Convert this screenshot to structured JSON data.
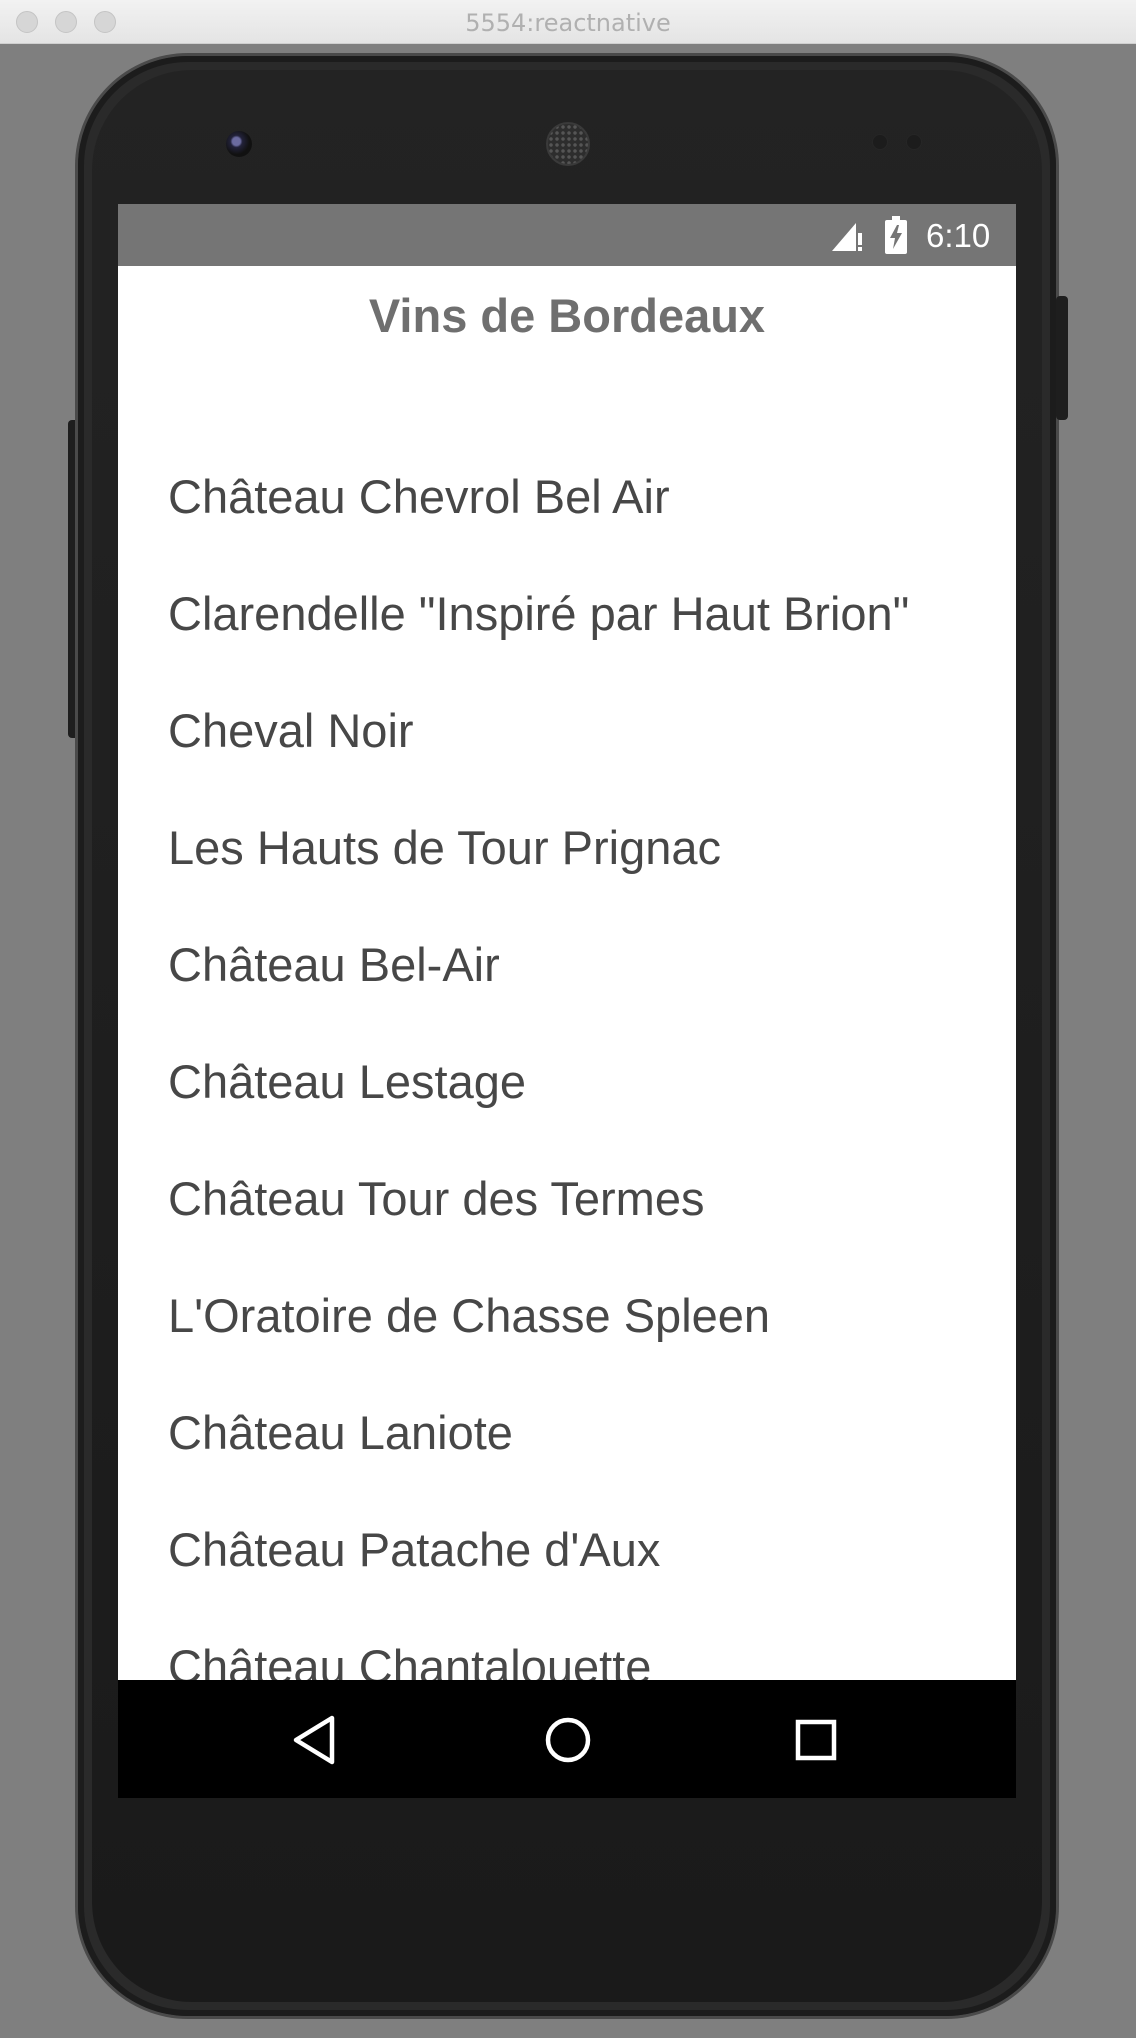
{
  "window": {
    "title": "5554:reactnative"
  },
  "status_bar": {
    "time": "6:10",
    "signal_icon": "signal-no-data-icon",
    "battery_icon": "battery-charging-icon"
  },
  "app": {
    "title": "Vins de Bordeaux",
    "wines": [
      "Château Chevrol Bel Air",
      "Clarendelle \"Inspiré par Haut Brion\"",
      "Cheval Noir",
      "Les Hauts de Tour Prignac",
      "Château Bel-Air",
      "Château Lestage",
      "Château Tour des Termes",
      "L'Oratoire de Chasse Spleen",
      "Château Laniote",
      "Château Patache d'Aux",
      "Château Chantalouette"
    ]
  },
  "nav_bar": {
    "icons": [
      "back-icon",
      "home-icon",
      "recents-icon"
    ]
  },
  "colors": {
    "status_bar": "#757575",
    "title_text": "#6f6f6f",
    "list_text": "#474747",
    "nav_bar": "#000000",
    "background": "#7f7f7f"
  }
}
